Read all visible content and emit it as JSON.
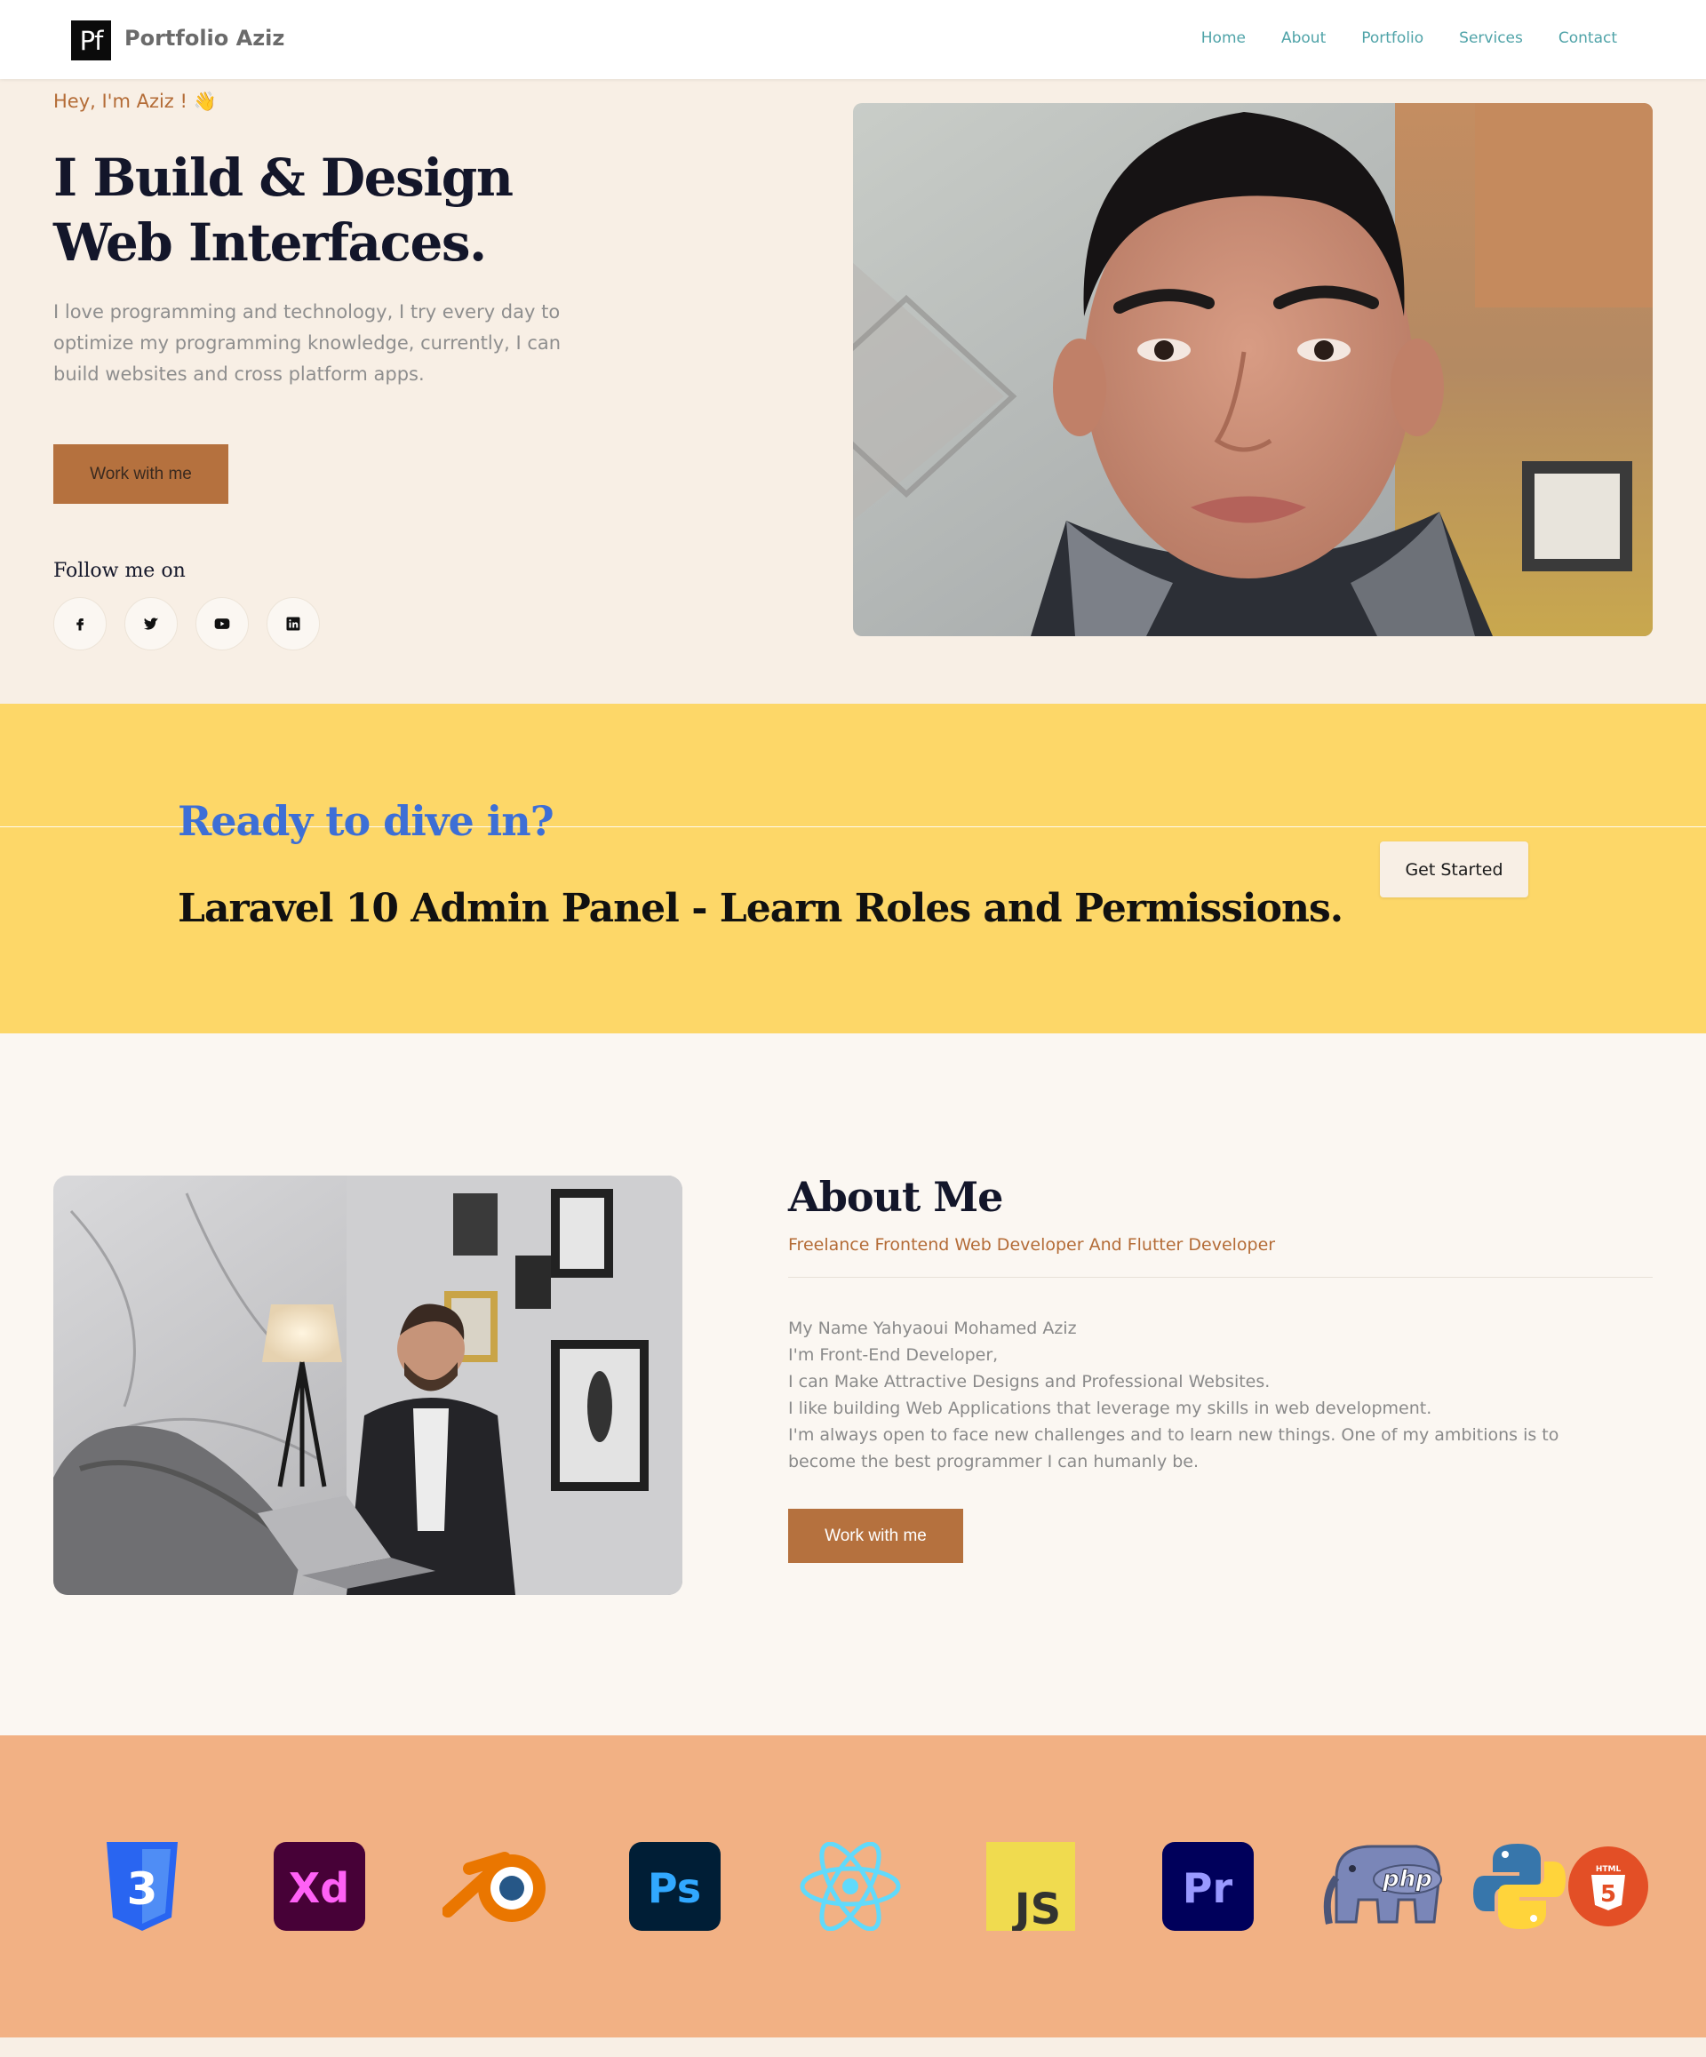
{
  "nav": {
    "logo_mark": "Pf",
    "brand": "Portfolio Aziz",
    "links": [
      "Home",
      "About",
      "Portfolio",
      "Services",
      "Contact"
    ]
  },
  "hero": {
    "greeting": "Hey, I'm Aziz ! 👋",
    "title": "I Build & Design\nWeb Interfaces.",
    "description": "I love programming and technology, I try every day to optimize my programming knowledge, currently, I can build websites and cross platform apps.",
    "cta": "Work with me",
    "follow_label": "Follow me on",
    "socials": [
      "facebook-icon",
      "twitter-icon",
      "youtube-icon",
      "linkedin-icon"
    ]
  },
  "cta_banner": {
    "kicker": "Ready to dive in?",
    "title": "Laravel 10 Admin Panel - Learn Roles and Permissions.",
    "button": "Get Started"
  },
  "about": {
    "title": "About Me",
    "subtitle": "Freelance Frontend Web Developer And Flutter Developer",
    "lines": [
      "My Name Yahyaoui Mohamed Aziz",
      "I'm Front-End Developer,",
      "I can Make Attractive Designs and Professional Websites.",
      "I like building Web Applications that leverage my skills in web development.",
      "I'm always open to face new challenges and to learn new things. One of my ambitions is to become the best programmer I can humanly be."
    ],
    "cta": "Work with me"
  },
  "tech": {
    "icons": [
      "css3-icon",
      "adobe-xd-icon",
      "blender-icon",
      "photoshop-icon",
      "react-icon",
      "javascript-icon",
      "premiere-pro-icon",
      "php-icon",
      "python-icon",
      "html5-icon"
    ],
    "labels": {
      "xd": "Xd",
      "ps": "Ps",
      "js": "JS",
      "pr": "Pr",
      "php": "php",
      "html": "HTML",
      "css_num": "3",
      "html_num": "5"
    }
  },
  "colors": {
    "accent": "#b5713e",
    "nav_link": "#4fa3a8",
    "hero_bg": "#f8efe5",
    "cta_bg": "#fdd768",
    "cta_kicker": "#3d6fd6",
    "tech_bg": "#f2b184"
  }
}
